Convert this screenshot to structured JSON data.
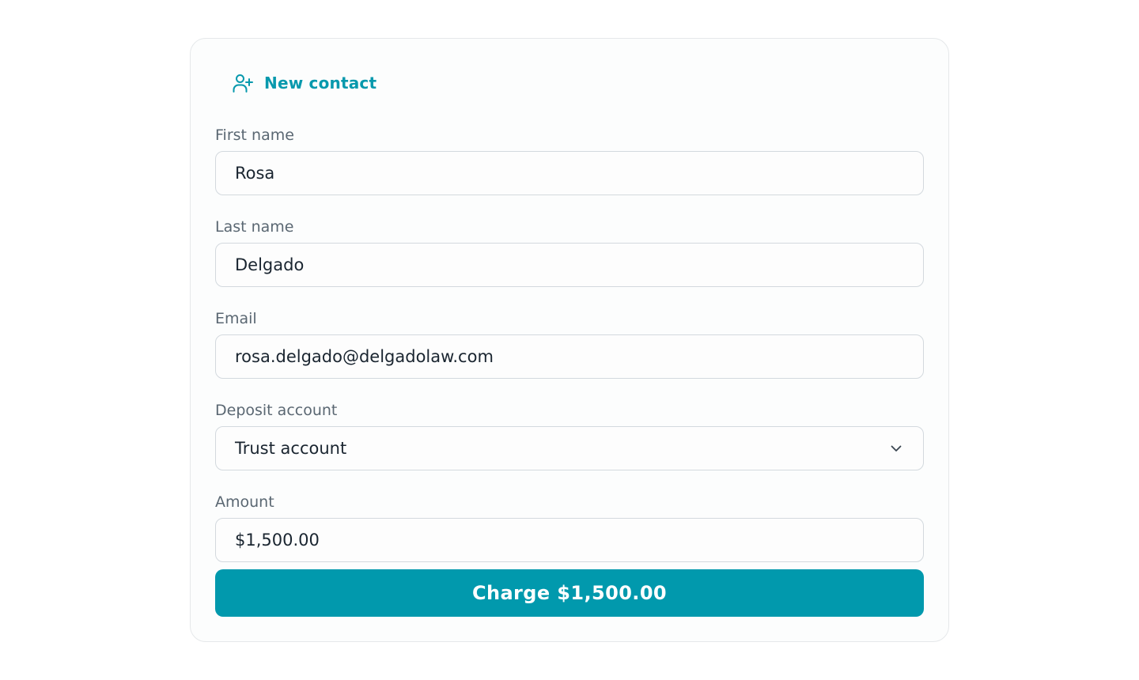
{
  "header": {
    "title": "New contact",
    "icon": "user-plus-icon",
    "accent_color": "#0799ad"
  },
  "form": {
    "first_name": {
      "label": "First name",
      "value": "Rosa"
    },
    "last_name": {
      "label": "Last name",
      "value": "Delgado"
    },
    "email": {
      "label": "Email",
      "value": "rosa.delgado@delgadolaw.com"
    },
    "deposit_account": {
      "label": "Deposit account",
      "value": "Trust account",
      "icon": "chevron-down-icon"
    },
    "amount": {
      "label": "Amount",
      "value": "$1,500.00"
    }
  },
  "charge_button": {
    "label": "Charge $1,500.00",
    "color": "#0199ad"
  }
}
